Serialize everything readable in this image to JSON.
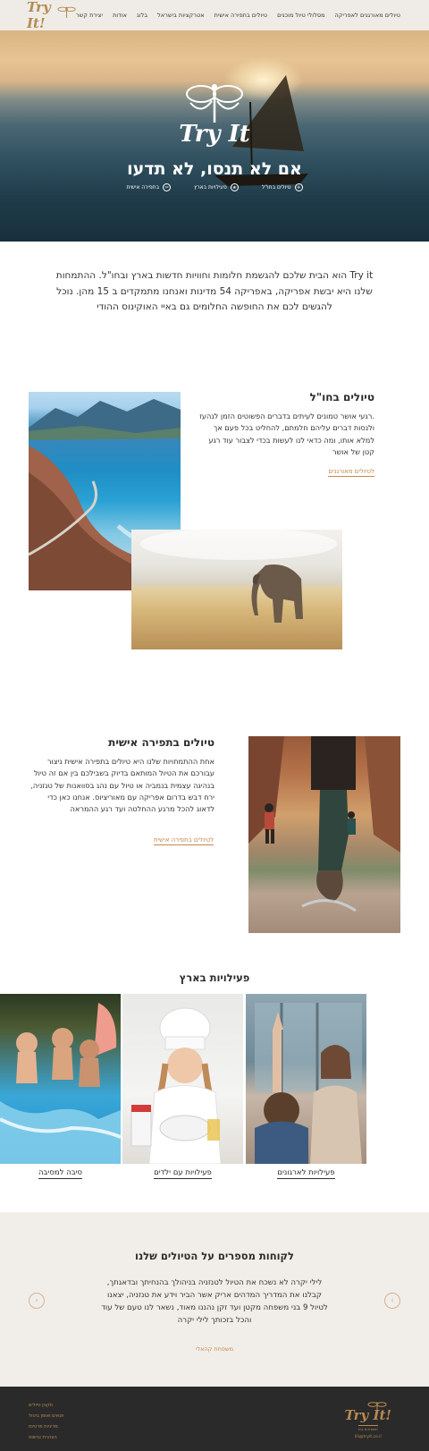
{
  "header": {
    "logo": "Try It!",
    "nav": [
      "טיולים מאורגנים לאפריקה",
      "מסלולי טיול מוכנים",
      "טיולים בתפירה אישית",
      "אטרקציות בישראל",
      "בלוג",
      "אודות",
      "יצירת קשר"
    ]
  },
  "hero": {
    "brand": "Try It",
    "title": "אם לא תנסו, לא תדעו",
    "links": [
      {
        "label": "טיולים בחו\"ל",
        "icon": "plane-icon"
      },
      {
        "label": "פעילויות בארץ",
        "icon": "star-icon"
      },
      {
        "label": "בתפירה אישית",
        "icon": "scissors-icon"
      }
    ]
  },
  "intro": {
    "text": "Try it  הוא הבית שלכם להגשמת חלומות וחוויות חדשות בארץ ובחו\"ל. ההתמחות שלנו היא יבשת אפריקה, באפריקה 54 מדינות ואנחנו מתמקדים ב 15 מהן. נוכל להגשים לכם את החופשה החלומים גם באיי האוקינוס ההודי"
  },
  "abroad": {
    "title": "טיולים בחו\"ל",
    "text": ".רגעי אושר טמונים לעיתים בדברים הפשוטים הזמן לנהעז ולנסות דברים עליהם חלמתם, להחליט בכל פעם אך למלא אותו, ומה כדאי לנו לעשות בכדי לצבור עוד רגע קטן של אושר",
    "link": "לטיולים מאורגנים"
  },
  "personal": {
    "title": "טיולים בתפירה אישית",
    "text": "אחת ההתמחויות שלנו היא טיולים בתפירה אישית ניצור עבורכם את הטיול המותאם בדיוק בשבילכם בין אם זה טיול בנהיגה עצמית בנמביה או טיול עם נהג בסוואנות של טנזניה, ירח דבש בדרום אפריקה עם מאוריציוס. אנחנו כאן כדי לדאוג להכל מרגע ההחלטה ועד רגע ההמראה",
    "link": "לטיולים בתפירה אישית"
  },
  "activities": {
    "title": "פעילויות בארץ",
    "items": [
      {
        "label": "פעילויות לארגונים"
      },
      {
        "label": "פעילויות עם ילדים"
      },
      {
        "label": "סיבה למסיבה"
      }
    ]
  },
  "testimonials": {
    "title": "לקוחות מספרים על הטיולים שלנו",
    "text": "לילי יקרה לא נשכח את הטיול לטנזניה בניהולך בהנחיתך ובדאגתך, קבלנו את המדריך המדהים אריק אשר הביר וידע את טנזניה, יצאנו לטיול 9 בני משפחה מקטן ועד זקן נהננו מאוד, נשאר לנו טעם של עוד והכל בזכותך לילי יקרה",
    "link": "משפחת קהאלי"
  },
  "footer": {
    "brand": "Try It!",
    "email": "lili@tryit.co.il",
    "tag": "try-it-travel",
    "links": [
      "תקנון טיולים",
      "תנאים ואופן ביטול",
      "מדיניות פרטיות",
      "הצהרת נגישות"
    ]
  },
  "colors": {
    "accent": "#c4894e",
    "header_bg": "#efece7",
    "footer_bg": "#2a2a2a",
    "testimonial_bg": "#f1eeea"
  }
}
